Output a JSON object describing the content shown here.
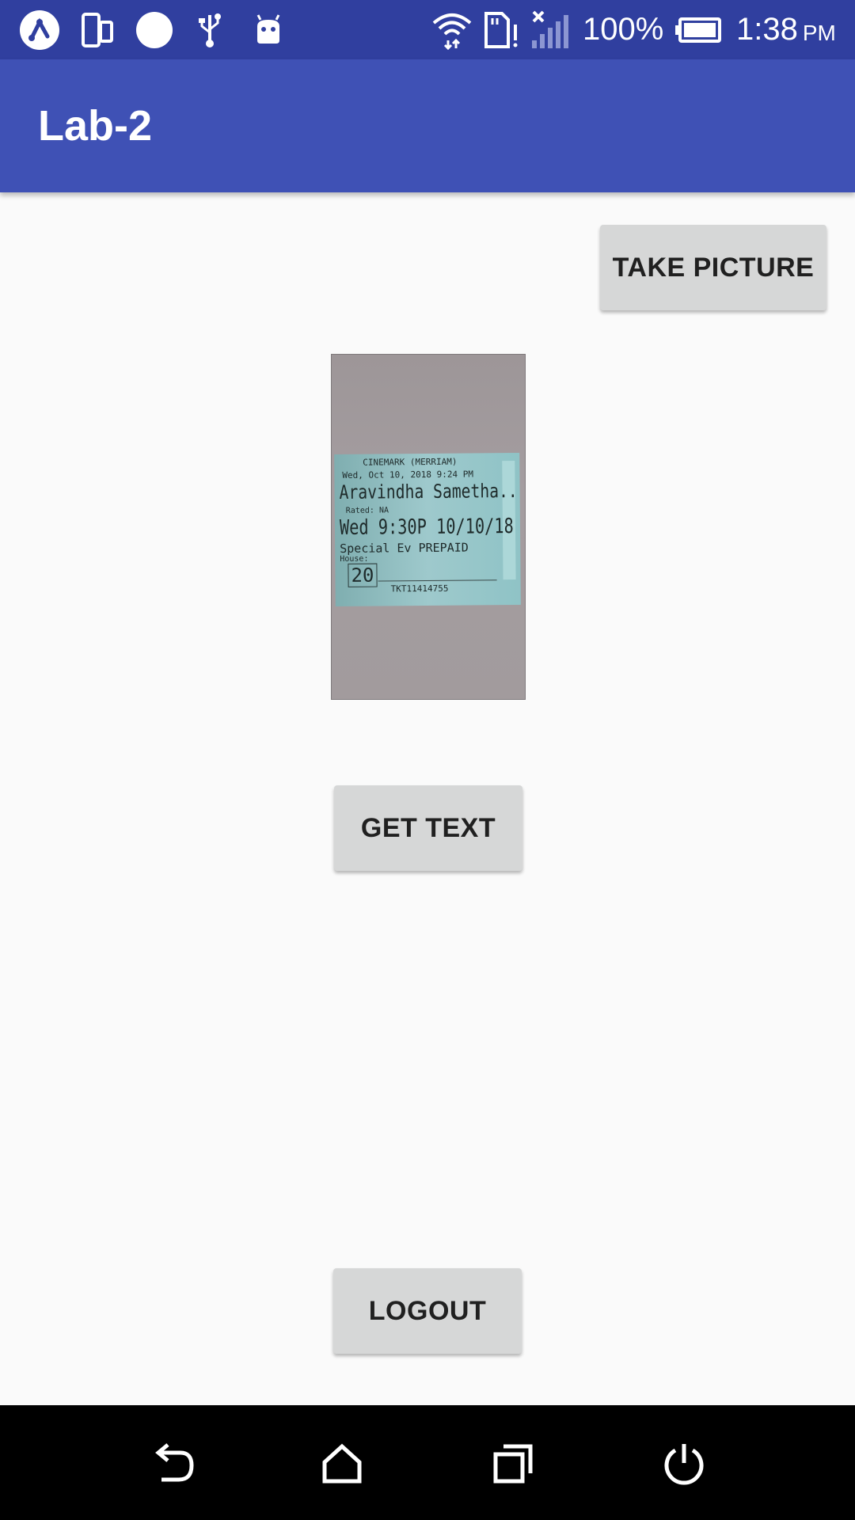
{
  "status_bar": {
    "icons": [
      "nfc-app-icon",
      "phone-tablet-icon",
      "circle-icon",
      "usb-icon",
      "android-icon",
      "wifi-icon",
      "sd-card-alert-icon",
      "signal-no-sim-icon",
      "battery-icon"
    ],
    "battery_percent": "100%",
    "time": "1:38",
    "time_suffix": "PM"
  },
  "app_bar": {
    "title": "Lab-2"
  },
  "buttons": {
    "take_picture": "TAKE PICTURE",
    "get_text": "GET TEXT",
    "logout": "LOGOUT"
  },
  "photo": {
    "ticket_lines": [
      "CINEMARK (MERRIAM)",
      "Wed, Oct 10, 2018 9:24 PM",
      "Aravindha Sametha..",
      "Rated: NA",
      "Wed 9:30P 10/10/18",
      "Special Ev PREPAID",
      "House:",
      "20",
      "TKT11414755"
    ]
  },
  "nav_bar": {
    "icons": [
      "back-icon",
      "home-icon",
      "recents-icon",
      "power-icon"
    ]
  }
}
